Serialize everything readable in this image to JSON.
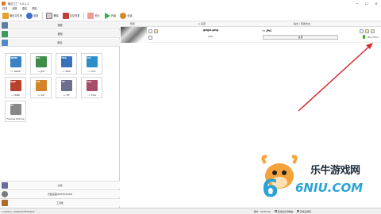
{
  "window": {
    "title": "格式工厂 5.0.1.1",
    "minimize": "—",
    "maximize": "☐",
    "close": "✕"
  },
  "menu": [
    "任务",
    "皮肤",
    "语言",
    "帮助"
  ],
  "toolbar": [
    {
      "label": "输出文件夹",
      "icon": "folder-icon",
      "color": "#e8a22b"
    },
    {
      "label": "选项",
      "icon": "options-icon",
      "color": "#3a6fd1"
    },
    {
      "label": "移除",
      "icon": "remove-icon",
      "color": "#7a7a7a"
    },
    {
      "label": "清空列表",
      "icon": "clear-list-icon",
      "color": "#c43d3d"
    },
    {
      "label": "停止",
      "icon": "stop-icon",
      "color": "#f19a9a"
    },
    {
      "label": "开始",
      "icon": "start-icon",
      "color": "#2fb24a"
    },
    {
      "label": "全选",
      "icon": "select-all-icon",
      "color": "#d48a2b"
    }
  ],
  "left_categories": [
    {
      "label": "视频",
      "icon": "video-icon",
      "color": "#5b7fa6"
    },
    {
      "label": "音频",
      "icon": "audio-icon",
      "color": "#3a9b5b"
    },
    {
      "label": "图片",
      "icon": "picture-icon",
      "color": "#4d8ac9"
    }
  ],
  "picture_tiles": [
    {
      "tag": "WEBP",
      "label": "-> WebP",
      "color": "#3b82c4"
    },
    {
      "tag": "JPG",
      "label": "-> JPG",
      "color": "#3f8b4a"
    },
    {
      "tag": "PNG",
      "label": "-> PNG",
      "color": "#3972b8"
    },
    {
      "tag": "ICO",
      "label": "-> ICO",
      "color": "#2b8fc7"
    },
    {
      "tag": "BMP",
      "label": "-> BMP",
      "color": "#b7432f"
    },
    {
      "tag": "GIF",
      "label": "-> GIF",
      "color": "#d3832a"
    },
    {
      "tag": "TIF",
      "label": "-> TIF",
      "color": "#6d6d8c"
    },
    {
      "tag": "TGA",
      "label": "-> TGA",
      "color": "#a64d6a"
    },
    {
      "tag": "FF",
      "label": "Frames Picture",
      "color": "#888888"
    }
  ],
  "bottom_sections": [
    {
      "label": "文档",
      "icon": "document-icon",
      "color": "#6a6a9a"
    },
    {
      "label": "光驱设备\\DVD\\CD\\ISO",
      "icon": "disc-icon",
      "color": "#7b7b7b"
    },
    {
      "label": "工具集",
      "icon": "tools-icon",
      "color": "#b06a2a"
    }
  ],
  "file_list": {
    "headers": [
      "预览",
      "1 来源",
      "输出 / 转换状态"
    ],
    "rows": [
      {
        "name": "gege.png",
        "size": "20K",
        "target": "-> JPG",
        "options_label": "选项",
        "status": "-46 (76%)"
      }
    ]
  },
  "statusbar": {
    "path": "C:\\Users\\...\\Desktop\\FFOutput",
    "check1": "完成后关闭电脑",
    "check2": "完成后通知",
    "right": "用时：00:00:00"
  },
  "watermark": {
    "cn": "乐牛游戏网",
    "en": "6NIU.COM"
  }
}
